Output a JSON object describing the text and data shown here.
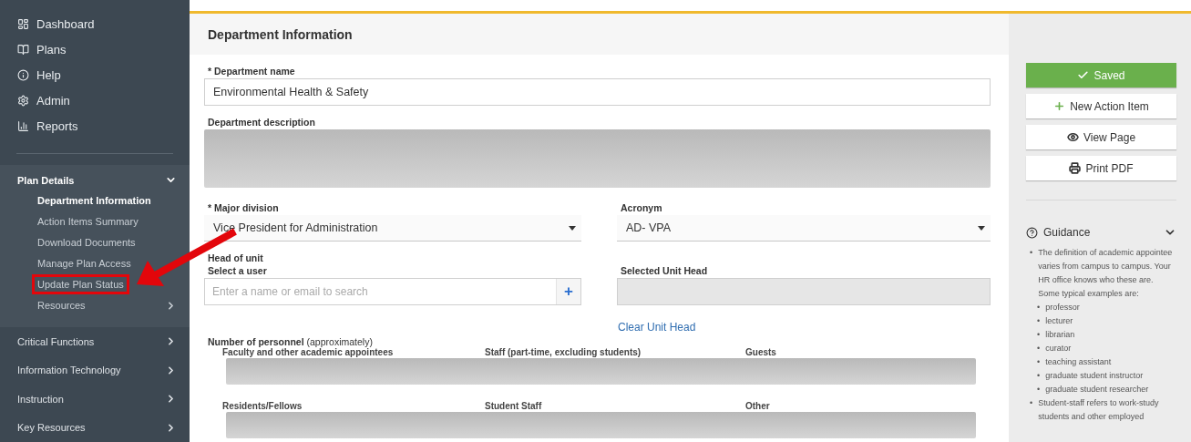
{
  "sidebar": {
    "nav": [
      {
        "label": "Dashboard"
      },
      {
        "label": "Plans"
      },
      {
        "label": "Help"
      },
      {
        "label": "Admin"
      },
      {
        "label": "Reports"
      }
    ],
    "sections": [
      {
        "label": "Plan Details",
        "expanded": true,
        "children": [
          {
            "label": "Department Information",
            "kind": "link",
            "selected": true,
            "annotated": false
          },
          {
            "label": "Action Items Summary",
            "kind": "link",
            "selected": false,
            "annotated": false
          },
          {
            "label": "Download Documents",
            "kind": "link",
            "selected": false,
            "annotated": false
          },
          {
            "label": "Manage Plan Access",
            "kind": "link",
            "selected": false,
            "annotated": false
          },
          {
            "label": "Update Plan Status",
            "kind": "link",
            "selected": false,
            "annotated": true
          },
          {
            "label": "Resources",
            "kind": "group",
            "selected": false,
            "annotated": false
          }
        ]
      },
      {
        "label": "Critical Functions",
        "expanded": false
      },
      {
        "label": "Information Technology",
        "expanded": false
      },
      {
        "label": "Instruction",
        "expanded": false
      },
      {
        "label": "Key Resources",
        "expanded": false
      }
    ]
  },
  "main": {
    "title": "Department Information",
    "department_name": {
      "label": "* Department name",
      "value": "Environmental Health & Safety"
    },
    "department_description": {
      "label": "Department description"
    },
    "major_division": {
      "label": "* Major division",
      "value": "Vice President for Administration"
    },
    "acronym": {
      "label": "Acronym",
      "value": "AD- VPA"
    },
    "head_of_unit": {
      "label": "Head of unit",
      "search_label": "Select a user",
      "placeholder": "Enter a name or email to search",
      "add": "+"
    },
    "selected_unit_head": {
      "label": "Selected Unit Head"
    },
    "clear_link": "Clear Unit Head",
    "personnel": {
      "title": "**Number of personnel** (approximately)",
      "rows": [
        [
          "Faculty and other academic appointees",
          "Staff (part-time, excluding students)",
          "Guests"
        ],
        [
          "Residents/Fellows",
          "Student Staff",
          "Other"
        ]
      ]
    }
  },
  "actions": [
    {
      "label": "Saved",
      "kind": "primary"
    },
    {
      "label": "New Action Item",
      "kind": "add"
    },
    {
      "label": "View Page",
      "kind": "view"
    },
    {
      "label": "Print PDF",
      "kind": "print"
    }
  ],
  "guidance": {
    "title": "Guidance",
    "expanded": true,
    "items": [
      {
        "marker": "•",
        "text": "The definition of academic appointee varies from campus to campus. Your HR office knows who these are. Some typical examples are:",
        "children": [
          {
            "marker": "•",
            "text": "professor"
          },
          {
            "marker": "•",
            "text": "lecturer"
          },
          {
            "marker": "•",
            "text": "librarian"
          },
          {
            "marker": "•",
            "text": "curator"
          },
          {
            "marker": "•",
            "text": "teaching assistant"
          },
          {
            "marker": "•",
            "text": "graduate student instructor"
          },
          {
            "marker": "•",
            "text": "graduate student researcher"
          }
        ]
      },
      {
        "marker": "•",
        "text": "Student-staff refers to work-study students and other employed"
      }
    ]
  }
}
